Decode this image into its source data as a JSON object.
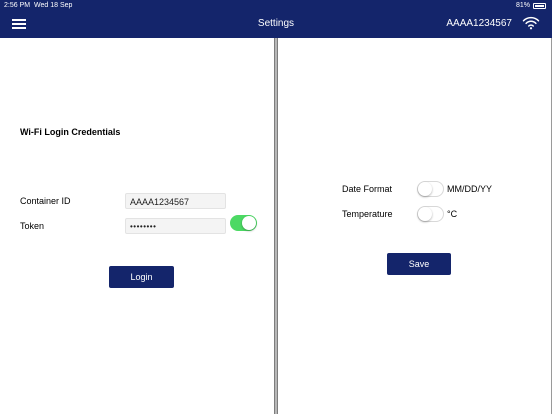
{
  "status_bar": {
    "time": "2:56 PM",
    "date": "Wed 18 Sep",
    "battery": "81%"
  },
  "nav": {
    "title": "Settings",
    "container_id": "AAAA1234567"
  },
  "login": {
    "section_title": "Wi-Fi Login Credentials",
    "container_label": "Container ID",
    "container_value": "AAAA1234567",
    "token_label": "Token",
    "token_value": "••••••••",
    "show_token_toggle": true,
    "login_button": "Login"
  },
  "settings": {
    "date_format_label": "Date Format",
    "date_format_value": "MM/DD/YY",
    "date_format_toggle": false,
    "temperature_label": "Temperature",
    "temperature_value": "°C",
    "temperature_toggle": false,
    "save_button": "Save"
  },
  "colors": {
    "nav_bg": "#14256b",
    "toggle_on": "#4cd964"
  }
}
